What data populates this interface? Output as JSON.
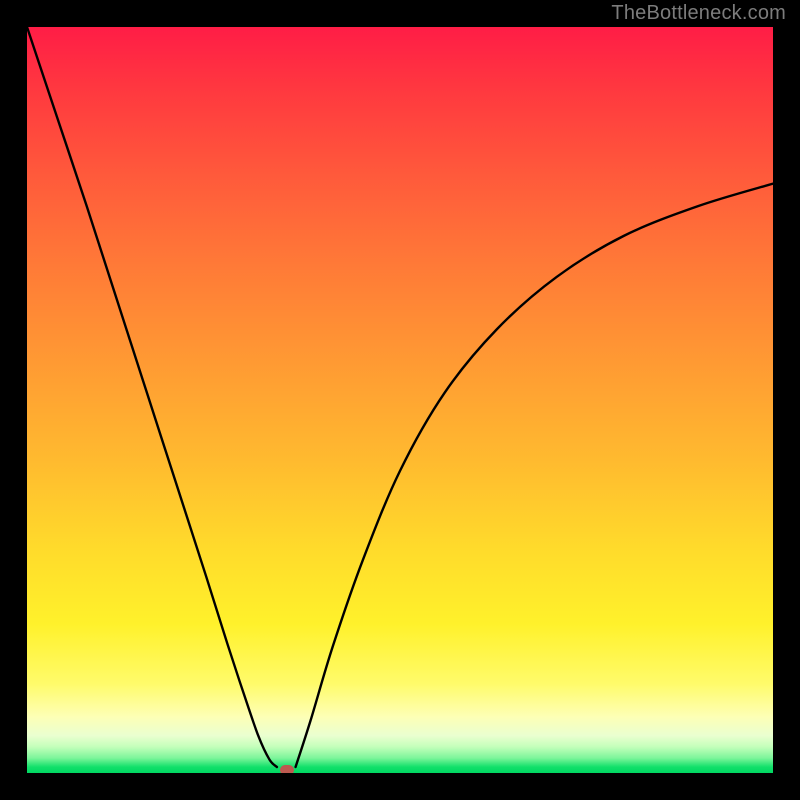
{
  "watermark": "TheBottleneck.com",
  "chart_data": {
    "type": "line",
    "title": "",
    "xlabel": "",
    "ylabel": "",
    "xlim": [
      0,
      1
    ],
    "ylim": [
      0,
      1
    ],
    "legend": false,
    "grid": false,
    "series": [
      {
        "name": "curve-left",
        "x": [
          0.0,
          0.04,
          0.08,
          0.12,
          0.16,
          0.2,
          0.24,
          0.269,
          0.29,
          0.31,
          0.325,
          0.335
        ],
        "values": [
          1.0,
          0.88,
          0.76,
          0.636,
          0.512,
          0.388,
          0.264,
          0.172,
          0.108,
          0.05,
          0.018,
          0.008
        ]
      },
      {
        "name": "curve-right",
        "x": [
          0.36,
          0.38,
          0.41,
          0.45,
          0.5,
          0.56,
          0.63,
          0.71,
          0.8,
          0.9,
          1.0
        ],
        "values": [
          0.008,
          0.07,
          0.17,
          0.285,
          0.405,
          0.51,
          0.595,
          0.665,
          0.72,
          0.76,
          0.79
        ]
      }
    ],
    "marker": {
      "x": 0.348,
      "y": 0.004
    },
    "background_gradient": {
      "top": "#ff1d46",
      "mid": "#ffe22b",
      "bottom": "#00d862"
    },
    "frame_color": "#000000"
  }
}
